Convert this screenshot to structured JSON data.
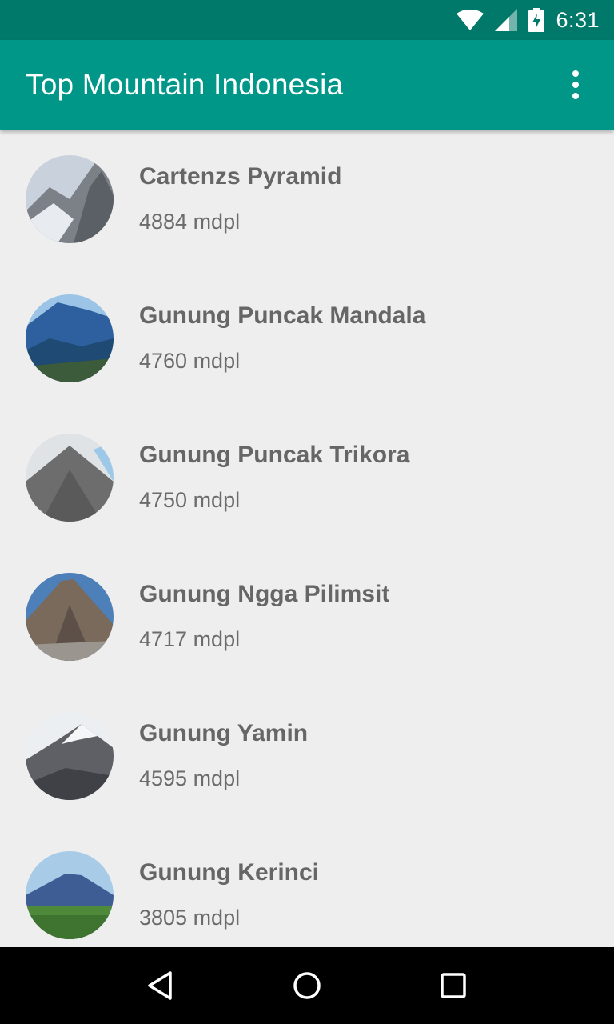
{
  "status_bar": {
    "time": "6:31",
    "icons": [
      "wifi-icon",
      "cell-signal-icon",
      "battery-charging-icon"
    ]
  },
  "app_bar": {
    "title": "Top Mountain Indonesia",
    "overflow_icon": "more-vert-icon"
  },
  "mountains": [
    {
      "name": "Cartenzs Pyramid",
      "height": "4884 mdpl"
    },
    {
      "name": "Gunung Puncak Mandala",
      "height": "4760 mdpl"
    },
    {
      "name": "Gunung Puncak Trikora",
      "height": "4750 mdpl"
    },
    {
      "name": "Gunung Ngga Pilimsit",
      "height": "4717 mdpl"
    },
    {
      "name": "Gunung Yamin",
      "height": "4595 mdpl"
    },
    {
      "name": "Gunung Kerinci",
      "height": "3805 mdpl"
    }
  ],
  "nav_bar": {
    "icons": [
      "back-icon",
      "home-icon",
      "recents-icon"
    ]
  },
  "colors": {
    "primary": "#009688",
    "primary_dark": "#00796b",
    "background": "#eeeeee",
    "text": "#666666"
  }
}
